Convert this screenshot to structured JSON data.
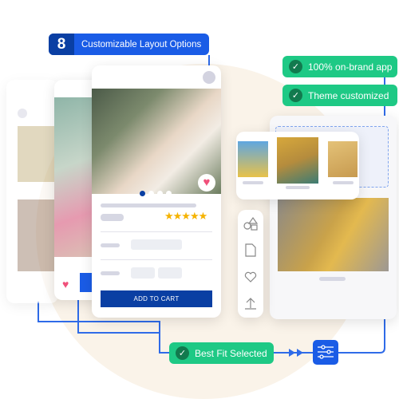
{
  "layout_badge": {
    "number": "8",
    "label": "Customizable Layout Options"
  },
  "status_badges": [
    "100% on-brand app",
    "Theme customized"
  ],
  "product_card": {
    "rating": 5,
    "add_to_cart": "ADD TO CART",
    "carousel_dots": 4,
    "active_dot": 1
  },
  "best_fit": {
    "label": "Best Fit Selected"
  },
  "colors": {
    "primary": "#1a5ce6",
    "dark_blue": "#0a3fa3",
    "green": "#1ec985",
    "star": "#f5b301",
    "heart": "#f0507a",
    "background_circle": "#faf3e9"
  },
  "toolbar_icons": [
    "shapes-icon",
    "document-icon",
    "heart-icon",
    "upload-icon"
  ]
}
